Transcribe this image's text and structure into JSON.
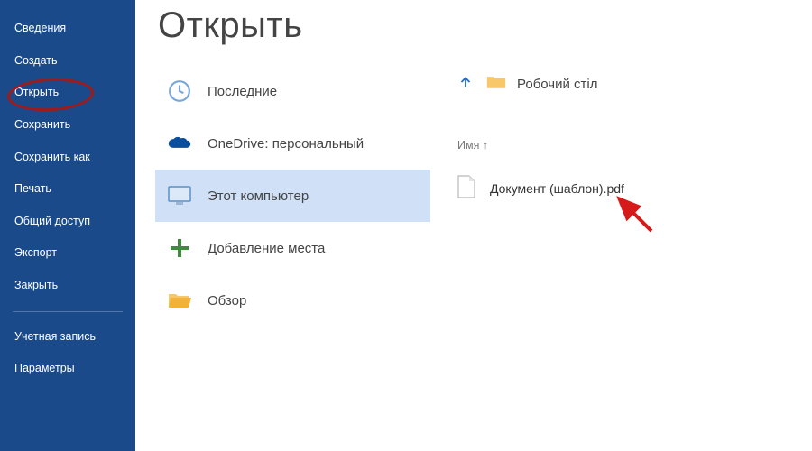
{
  "page_title": "Открыть",
  "sidebar": {
    "items": [
      {
        "label": "Сведения"
      },
      {
        "label": "Создать"
      },
      {
        "label": "Открыть",
        "active": true
      },
      {
        "label": "Сохранить"
      },
      {
        "label": "Сохранить как"
      },
      {
        "label": "Печать"
      },
      {
        "label": "Общий доступ"
      },
      {
        "label": "Экспорт"
      },
      {
        "label": "Закрыть"
      }
    ],
    "bottom_items": [
      {
        "label": "Учетная запись"
      },
      {
        "label": "Параметры"
      }
    ]
  },
  "sources": [
    {
      "id": "recent",
      "label": "Последние"
    },
    {
      "id": "onedrive",
      "label": "OneDrive: персональный"
    },
    {
      "id": "this-pc",
      "label": "Этот компьютер",
      "selected": true
    },
    {
      "id": "add-place",
      "label": "Добавление места"
    },
    {
      "id": "browse",
      "label": "Обзор"
    }
  ],
  "location": {
    "folder_label": "Робочий стіл"
  },
  "file_column_header": "Имя ↑",
  "files": [
    {
      "name": "Документ (шаблон).pdf"
    }
  ],
  "colors": {
    "sidebar_bg": "#1a4a8a",
    "selected_bg": "#cfe0f7",
    "accent": "#2a6ec6",
    "annotation_red": "#d61a1a"
  }
}
